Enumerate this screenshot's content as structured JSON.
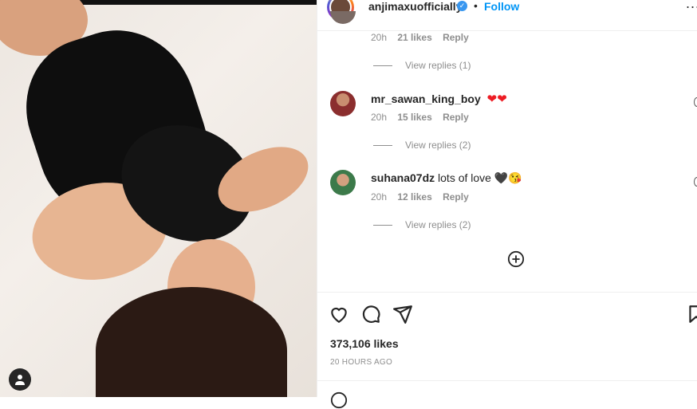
{
  "header": {
    "username": "anjimaxuofficially",
    "separator": "•",
    "follow_label": "Follow",
    "more_label": "..."
  },
  "comments": [
    {
      "time": "20h",
      "likes": "21 likes",
      "reply": "Reply",
      "view_replies": "View replies (1)"
    },
    {
      "username": "mr_sawan_king_boy",
      "text": "",
      "emoji": "❤❤",
      "time": "20h",
      "likes": "15 likes",
      "reply": "Reply",
      "view_replies": "View replies (2)"
    },
    {
      "username": "suhana07dz",
      "text": "lots of love",
      "emoji": "🖤😘",
      "time": "20h",
      "likes": "12 likes",
      "reply": "Reply",
      "view_replies": "View replies (2)"
    }
  ],
  "post": {
    "likes": "373,106 likes",
    "timestamp": "20 HOURS AGO"
  },
  "colors": {
    "accent": "#0095f6",
    "secondary_text": "#8e8e8e",
    "heart": "#ed1c24"
  }
}
